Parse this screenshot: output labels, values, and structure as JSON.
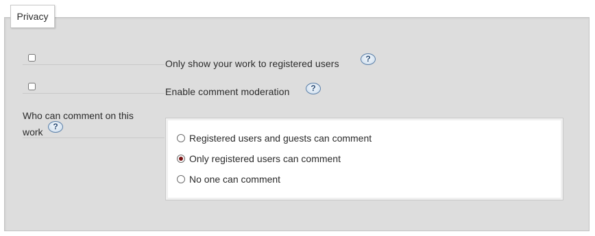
{
  "fieldset": {
    "legend": "Privacy"
  },
  "options": [
    {
      "label": "Only show your work to registered users",
      "checked": false,
      "help_icon": "question-mark",
      "help_text": "?"
    },
    {
      "label": "Enable comment moderation",
      "checked": false,
      "help_icon": "question-mark",
      "help_text": "?"
    }
  ],
  "comment_permissions": {
    "label": "Who can comment on this work",
    "help_icon": "question-mark",
    "help_text": "?",
    "choices": [
      {
        "label": "Registered users and guests can comment",
        "selected": false
      },
      {
        "label": "Only registered users can comment",
        "selected": true
      },
      {
        "label": "No one can comment",
        "selected": false
      }
    ]
  },
  "colors": {
    "fieldset_background": "#dddddd",
    "radio_selected": "#7a1212",
    "help_icon_border": "#5b7fa8"
  }
}
